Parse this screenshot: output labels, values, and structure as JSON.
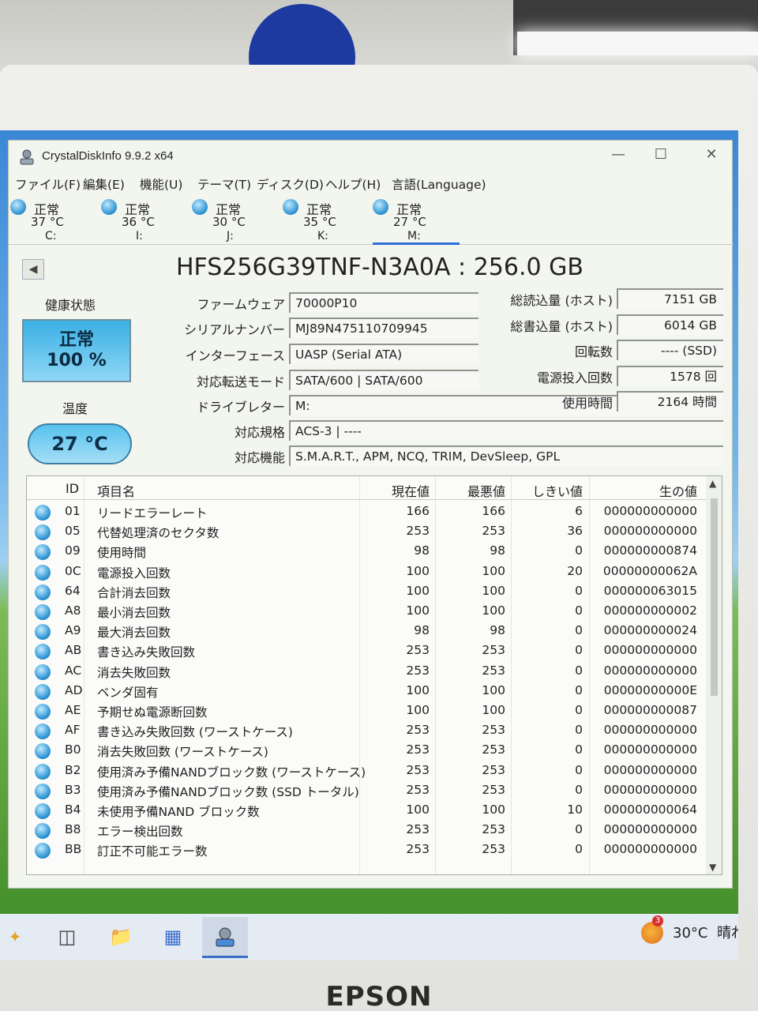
{
  "app": {
    "title": "CrystalDiskInfo 9.9.2 x64"
  },
  "menu": [
    "ファイル(F)",
    "編集(E)",
    "機能(U)",
    "テーマ(T)",
    "ディスク(D)",
    "ヘルプ(H)",
    "言語(Language)"
  ],
  "disks": [
    {
      "status": "正常",
      "temp": "37 °C",
      "letter": "C:"
    },
    {
      "status": "正常",
      "temp": "36 °C",
      "letter": "I:"
    },
    {
      "status": "正常",
      "temp": "30 °C",
      "letter": "J:"
    },
    {
      "status": "正常",
      "temp": "35 °C",
      "letter": "K:"
    },
    {
      "status": "正常",
      "temp": "27 °C",
      "letter": "M:"
    }
  ],
  "active_disk": "M:",
  "model": "HFS256G39TNF-N3A0A : 256.0 GB",
  "health": {
    "label": "健康状態",
    "status": "正常",
    "percent": "100 %"
  },
  "temperature": {
    "label": "温度",
    "value": "27 °C"
  },
  "info": {
    "firmware": {
      "label": "ファームウェア",
      "value": "70000P10"
    },
    "serial": {
      "label": "シリアルナンバー",
      "value": "MJ89N475110709945"
    },
    "interface": {
      "label": "インターフェース",
      "value": "UASP (Serial ATA)"
    },
    "transfer": {
      "label": "対応転送モード",
      "value": "SATA/600 | SATA/600"
    },
    "drive_letter": {
      "label": "ドライブレター",
      "value": "M:"
    },
    "standard": {
      "label": "対応規格",
      "value": "ACS-3 | ----"
    },
    "features": {
      "label": "対応機能",
      "value": "S.M.A.R.T., APM, NCQ, TRIM, DevSleep, GPL"
    },
    "total_reads": {
      "label": "総読込量 (ホスト)",
      "value": "7151 GB"
    },
    "total_writes": {
      "label": "総書込量 (ホスト)",
      "value": "6014 GB"
    },
    "rotation": {
      "label": "回転数",
      "value": "---- (SSD)"
    },
    "power_on_count": {
      "label": "電源投入回数",
      "value": "1578 回"
    },
    "power_on_hours": {
      "label": "使用時間",
      "value": "2164 時間"
    }
  },
  "smart": {
    "headers": [
      "ID",
      "項目名",
      "現在値",
      "最悪値",
      "しきい値",
      "生の値"
    ],
    "rows": [
      [
        "01",
        "リードエラーレート",
        "166",
        "166",
        "6",
        "000000000000"
      ],
      [
        "05",
        "代替処理済のセクタ数",
        "253",
        "253",
        "36",
        "000000000000"
      ],
      [
        "09",
        "使用時間",
        "98",
        "98",
        "0",
        "000000000874"
      ],
      [
        "0C",
        "電源投入回数",
        "100",
        "100",
        "20",
        "00000000062A"
      ],
      [
        "64",
        "合計消去回数",
        "100",
        "100",
        "0",
        "000000063015"
      ],
      [
        "A8",
        "最小消去回数",
        "100",
        "100",
        "0",
        "000000000002"
      ],
      [
        "A9",
        "最大消去回数",
        "98",
        "98",
        "0",
        "000000000024"
      ],
      [
        "AB",
        "書き込み失敗回数",
        "253",
        "253",
        "0",
        "000000000000"
      ],
      [
        "AC",
        "消去失敗回数",
        "253",
        "253",
        "0",
        "000000000000"
      ],
      [
        "AD",
        "ベンダ固有",
        "100",
        "100",
        "0",
        "00000000000E"
      ],
      [
        "AE",
        "予期せぬ電源断回数",
        "100",
        "100",
        "0",
        "000000000087"
      ],
      [
        "AF",
        "書き込み失敗回数 (ワーストケース)",
        "253",
        "253",
        "0",
        "000000000000"
      ],
      [
        "B0",
        "消去失敗回数 (ワーストケース)",
        "253",
        "253",
        "0",
        "000000000000"
      ],
      [
        "B2",
        "使用済み予備NANDブロック数 (ワーストケース)",
        "253",
        "253",
        "0",
        "000000000000"
      ],
      [
        "B3",
        "使用済み予備NANDブロック数 (SSD トータル)",
        "253",
        "253",
        "0",
        "000000000000"
      ],
      [
        "B4",
        "未使用予備NAND ブロック数",
        "100",
        "100",
        "10",
        "000000000064"
      ],
      [
        "B8",
        "エラー検出回数",
        "253",
        "253",
        "0",
        "000000000000"
      ],
      [
        "BB",
        "訂正不可能エラー数",
        "253",
        "253",
        "0",
        "000000000000"
      ]
    ]
  },
  "taskbar": {
    "weather_temp": "30°C",
    "weather_text": "晴れの",
    "notification_count": "3"
  },
  "monitor_brand": "EPSON"
}
